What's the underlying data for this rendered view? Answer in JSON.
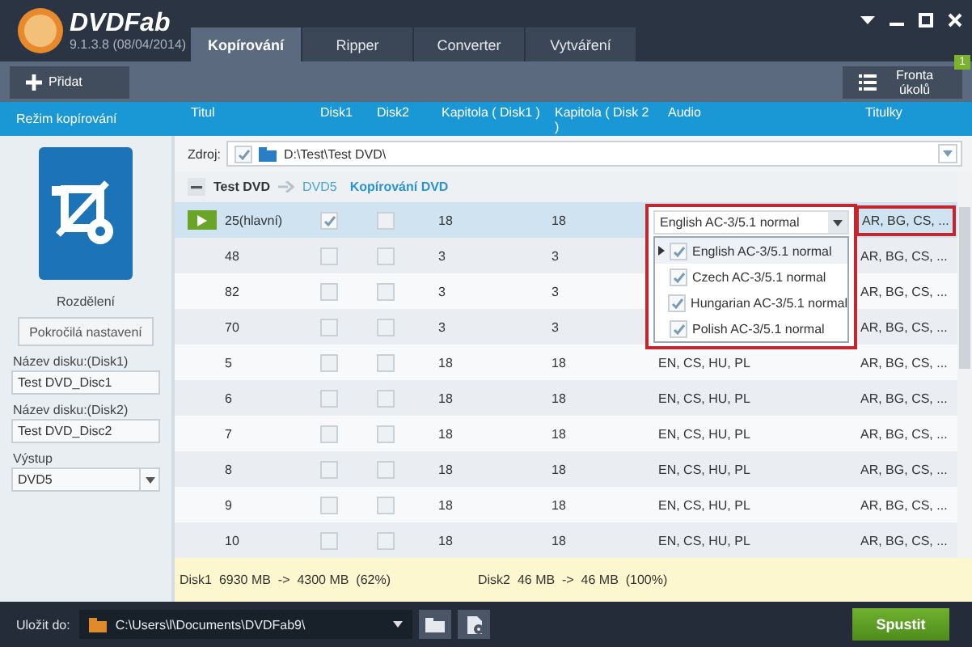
{
  "app": {
    "name": "DVDFab",
    "version": "9.1.3.8 (08/04/2014)"
  },
  "tabs": [
    {
      "label": "Kopírování",
      "selected": true
    },
    {
      "label": "Ripper",
      "selected": false
    },
    {
      "label": "Converter",
      "selected": false
    },
    {
      "label": "Vytváření",
      "selected": false
    }
  ],
  "toolbar": {
    "add_button": "Přidat",
    "queue_button": {
      "label": "Fronta úkolů",
      "badge": "1"
    }
  },
  "columns": [
    "Režim kopírování",
    "Titul",
    "Disk1",
    "Disk2",
    "Kapitola ( Disk1 )",
    "Kapitola ( Disk 2 )",
    "Audio",
    "Titulky"
  ],
  "sidebar": {
    "mode": "Rozdělení",
    "advanced_button": "Pokročilá nastavení",
    "fields": [
      {
        "label": "Název disku:(Disk1)",
        "value": "Test DVD_Disc1"
      },
      {
        "label": "Název disku:(Disk2)",
        "value": "Test DVD_Disc2"
      }
    ],
    "output": {
      "label": "Výstup",
      "value": "DVD5"
    }
  },
  "source": {
    "label": "Zdroj:",
    "checked": true,
    "path": "D:\\Test\\Test DVD\\"
  },
  "disc": {
    "title": "Test DVD",
    "target": "DVD5",
    "mode": "Kopírování DVD",
    "expanded": true
  },
  "rows": [
    {
      "kind": "main",
      "title": "25(hlavní)",
      "selected": true,
      "disk1": true,
      "disk2": false,
      "chapters1": "18",
      "chapters2": "18",
      "subtitles": "AR, BG, CS, ...",
      "subtitles_highlighted": true
    },
    {
      "kind": "title",
      "title": "48",
      "selected": false,
      "disk1": false,
      "disk2": false,
      "chapters1": "3",
      "chapters2": "3",
      "subtitles": "AR, BG, CS, ...",
      "subtitles_highlighted": false
    },
    {
      "kind": "title",
      "title": "82",
      "selected": false,
      "disk1": false,
      "disk2": false,
      "chapters1": "3",
      "chapters2": "3",
      "subtitles": "AR, BG, CS, ...",
      "subtitles_highlighted": false
    },
    {
      "kind": "title",
      "title": "70",
      "selected": false,
      "disk1": false,
      "disk2": false,
      "chapters1": "3",
      "chapters2": "3",
      "subtitles": "AR, BG, CS, ...",
      "subtitles_highlighted": false
    },
    {
      "kind": "title",
      "title": "5",
      "selected": false,
      "disk1": false,
      "disk2": false,
      "chapters1": "18",
      "chapters2": "18",
      "audio": "EN, CS, HU, PL",
      "subtitles": "AR, BG, CS, ...",
      "subtitles_highlighted": false
    },
    {
      "kind": "title",
      "title": "6",
      "selected": false,
      "disk1": false,
      "disk2": false,
      "chapters1": "18",
      "chapters2": "18",
      "audio": "EN, CS, HU, PL",
      "subtitles": "AR, BG, CS, ...",
      "subtitles_highlighted": false
    },
    {
      "kind": "title",
      "title": "7",
      "selected": false,
      "disk1": false,
      "disk2": false,
      "chapters1": "18",
      "chapters2": "18",
      "audio": "EN, CS, HU, PL",
      "subtitles": "AR, BG, CS, ...",
      "subtitles_highlighted": false
    },
    {
      "kind": "title",
      "title": "8",
      "selected": false,
      "disk1": false,
      "disk2": false,
      "chapters1": "18",
      "chapters2": "18",
      "audio": "EN, CS, HU, PL",
      "subtitles": "AR, BG, CS, ...",
      "subtitles_highlighted": false
    },
    {
      "kind": "title",
      "title": "9",
      "selected": false,
      "disk1": false,
      "disk2": false,
      "chapters1": "18",
      "chapters2": "18",
      "audio": "EN, CS, HU, PL",
      "subtitles": "AR, BG, CS, ...",
      "subtitles_highlighted": false
    },
    {
      "kind": "title",
      "title": "10",
      "selected": false,
      "disk1": false,
      "disk2": false,
      "chapters1": "18",
      "chapters2": "18",
      "audio": "EN, CS, HU, PL",
      "subtitles": "AR, BG, CS, ...",
      "subtitles_highlighted": false
    }
  ],
  "audio_dropdown": {
    "value": "English AC-3/5.1 normal",
    "options": [
      {
        "label": "English AC-3/5.1 normal",
        "checked": true,
        "selected": true
      },
      {
        "label": "Czech AC-3/5.1 normal",
        "checked": true,
        "selected": false
      },
      {
        "label": "Hungarian AC-3/5.1 normal",
        "checked": true,
        "selected": false
      },
      {
        "label": "Polish AC-3/5.1 normal",
        "checked": true,
        "selected": false
      }
    ]
  },
  "summary": [
    "Disk1  6930 MB  ->  4300 MB  (62%)",
    "Disk2  46 MB  ->  46 MB  (100%)"
  ],
  "bottom": {
    "save_label": "Uložit do:",
    "path": "C:\\Users\\l\\Documents\\DVDFab9\\",
    "start_button": "Spustit"
  }
}
